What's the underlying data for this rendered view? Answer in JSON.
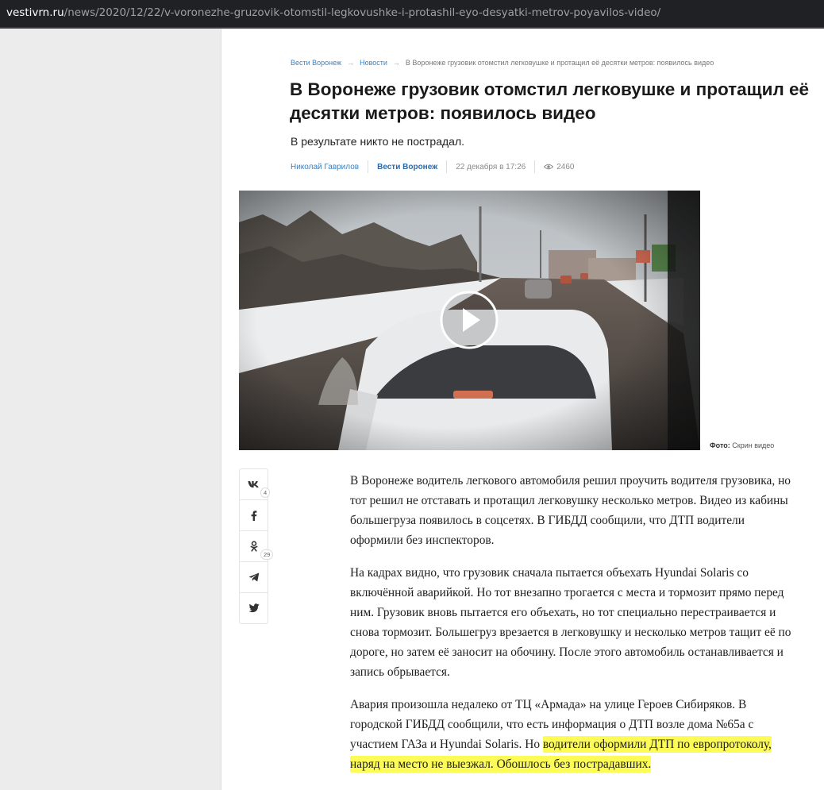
{
  "browser": {
    "url_domain": "vestivrn.ru",
    "url_path": "/news/2020/12/22/v-voronezhe-gruzovik-otomstil-legkovushke-i-protashil-eyo-desyatki-metrov-poyavilos-video/"
  },
  "breadcrumbs": {
    "home": "Вести Воронеж",
    "section": "Новости",
    "current": "В Воронеже грузовик отомстил легковушке и протащил её десятки метров: появилось видео",
    "separator": "→"
  },
  "article": {
    "title": "В Воронеже грузовик отомстил легковушке и протащил её десятки метров: появилось видео",
    "lead": "В результате никто не пострадал.",
    "author": "Николай Гаврилов",
    "source": "Вести Воронеж",
    "date": "22 декабря в 17:26",
    "views": "2460",
    "photo_credit_label": "Фото:",
    "photo_credit": "Скрин видео",
    "paragraphs": [
      "В Воронеже водитель легкового автомобиля решил проучить водителя грузовика, но тот решил не отставать и протащил легковушку несколько метров. Видео из кабины большегруза появилось в соцсетях. В ГИБДД сообщили, что ДТП водители оформили без инспекторов.",
      "На кадрах видно, что грузовик сначала пытается объехать Hyundai Solaris со включённой аварийкой. Но тот внезапно трогается с места и тормозит прямо перед ним. Грузовик вновь пытается его объехать, но тот специально перестраивается и снова тормозит. Большегруз врезается в легковушку и несколько метров тащит её по дороге, но затем её заносит на обочину. После этого автомобиль останавливается и запись обрывается."
    ],
    "paragraph3": {
      "text": "Авария произошла недалеко от ТЦ «Армада» на улице Героев Сибиряков. В городской ГИБДД сообщили, что есть информация о ДТП возле дома №65а с участием ГАЗа и Hyundai Solaris. Но ",
      "highlighted": "водители оформили ДТП по европротоколу, наряд на место не выезжал. Обошлось без пострадавших."
    }
  },
  "share": {
    "buttons": [
      {
        "icon": "vk-icon",
        "count": "4"
      },
      {
        "icon": "facebook-icon",
        "count": ""
      },
      {
        "icon": "odnoklassniki-icon",
        "count": "29"
      },
      {
        "icon": "telegram-icon",
        "count": ""
      },
      {
        "icon": "twitter-icon",
        "count": ""
      }
    ]
  },
  "colors": {
    "link": "#3a7fc1",
    "highlight": "#fdfb55",
    "urlbar": "#202124"
  }
}
